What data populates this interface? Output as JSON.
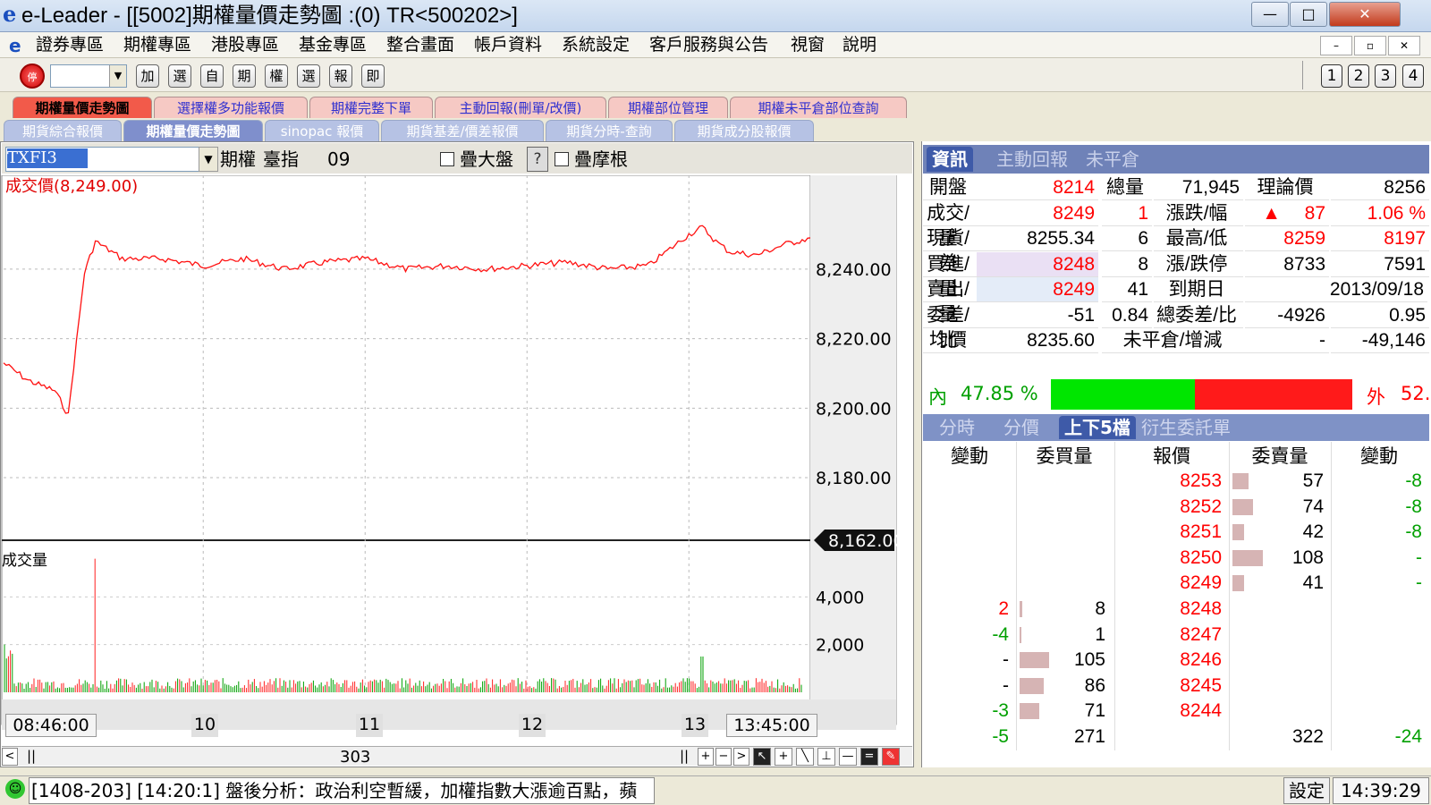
{
  "window": {
    "title": "e-Leader - [[5002]期權量價走勢圖 :(0) TR<500202>]",
    "logo": "e",
    "min": "—",
    "max": "□",
    "close": "✕"
  },
  "menu": [
    "證券專區",
    "期權專區",
    "港股專區",
    "基金專區",
    "整合畫面",
    "帳戶資料",
    "系統設定",
    "客戶服務與公告",
    "視窗",
    "說明"
  ],
  "mdi_buttons": [
    "–",
    "▫",
    "✕"
  ],
  "toolbar": {
    "stop": "停",
    "combo_value": "",
    "buttons": [
      "加",
      "選",
      "自",
      "期",
      "權",
      "選",
      "報",
      "即"
    ],
    "layout_buttons": [
      "1",
      "2",
      "3",
      "4"
    ]
  },
  "tabs_row1": [
    "期權量價走勢圖",
    "選擇權多功能報價",
    "期權完整下單",
    "主動回報(刪單/改價)",
    "期權部位管理",
    "期權未平倉部位查詢"
  ],
  "tabs_row2": [
    "期貨綜合報價",
    "期權量價走勢圖",
    "sinopac 報價",
    "期貨基差/價差報價",
    "期貨分時-查詢",
    "期貨成分股報價"
  ],
  "symbol": {
    "code": "TXFI3",
    "type": "期權",
    "name": "臺指",
    "month": "09",
    "overlay_index": "疊大盤",
    "help": "?",
    "overlay_msci": "疊摩根"
  },
  "chart": {
    "price_label": "成交價(8,249.00)",
    "volume_label": "成交量",
    "y_price_ticks": [
      "8,240.00",
      "8,220.00",
      "8,200.00",
      "8,180.00"
    ],
    "current_price_tag": "8,162.00",
    "y_volume_ticks": [
      "4,000",
      "2,000"
    ],
    "x_start": "08:46:00",
    "x_ticks": [
      "10",
      "11",
      "12",
      "13"
    ],
    "x_end": "13:45:00",
    "scroll_value": "303"
  },
  "chart_data": {
    "type": "line",
    "title": "成交價(8,249.00)",
    "ylabel": "",
    "ylim": [
      8162,
      8267
    ],
    "x_range": [
      "08:46",
      "13:45"
    ],
    "series": [
      {
        "name": "成交價",
        "x": [
          "08:46",
          "08:55",
          "09:05",
          "09:10",
          "09:13",
          "09:16",
          "09:20",
          "09:30",
          "09:45",
          "10:00",
          "10:15",
          "10:30",
          "10:45",
          "11:00",
          "11:15",
          "11:30",
          "11:45",
          "12:00",
          "12:15",
          "12:30",
          "12:45",
          "13:00",
          "13:05",
          "13:10",
          "13:15",
          "13:25",
          "13:35",
          "13:45"
        ],
        "values": [
          8213,
          8208,
          8205,
          8198,
          8219,
          8239,
          8248,
          8243,
          8243,
          8241,
          8243,
          8240,
          8242,
          8243,
          8240,
          8241,
          8240,
          8241,
          8242,
          8240,
          8241,
          8250,
          8252,
          8248,
          8245,
          8244,
          8247,
          8249
        ]
      }
    ],
    "volume": {
      "ylim": [
        0,
        6000
      ],
      "spike_times": [
        "08:46",
        "09:20",
        "13:05"
      ],
      "spike_values": [
        2000,
        5600,
        1500
      ]
    }
  },
  "info": {
    "tabs": [
      "資訊",
      "主動回報",
      "未平倉"
    ],
    "rows": [
      [
        "開盤",
        "8214",
        "總量",
        "71,945",
        "理論價",
        "",
        "8256"
      ],
      [
        "成交/量",
        "8249",
        "1",
        "漲跌/幅",
        "▲",
        "87",
        "1.06 %"
      ],
      [
        "現貨/差",
        "8255.34",
        "6",
        "最高/低",
        "8259",
        "8197"
      ],
      [
        "買進/量",
        "8248",
        "8",
        "漲/跌停",
        "8733",
        "7591"
      ],
      [
        "賣出/量",
        "8249",
        "41",
        "到期日",
        "2013/09/18"
      ],
      [
        "委差/比",
        "-51",
        "0.84",
        "總委差/比",
        "-4926",
        "0.95"
      ],
      [
        "均價",
        "8235.60",
        "未平倉/增減",
        "-",
        "-49,146"
      ]
    ]
  },
  "inout": {
    "in_label": "內",
    "in_pct": "47.85 %",
    "out_label": "外",
    "out_pct": "52.",
    "in_value": 47.85
  },
  "book": {
    "tabs": [
      "分時",
      "分價",
      "上下5檔",
      "衍生委託單"
    ],
    "headers": [
      "變動",
      "委買量",
      "報價",
      "委賣量",
      "變動"
    ],
    "asks": [
      [
        "8253",
        "57",
        "-8"
      ],
      [
        "8252",
        "74",
        "-8"
      ],
      [
        "8251",
        "42",
        "-8"
      ],
      [
        "8250",
        "108",
        "-"
      ],
      [
        "8249",
        "41",
        "-"
      ]
    ],
    "bids": [
      [
        "2",
        "8",
        "8248"
      ],
      [
        "-4",
        "1",
        "8247"
      ],
      [
        "-",
        "105",
        "8246"
      ],
      [
        "-",
        "86",
        "8245"
      ],
      [
        "-3",
        "71",
        "8244"
      ]
    ],
    "totals": [
      "-5",
      "271",
      "322",
      "-24"
    ]
  },
  "status": {
    "news": "[1408-203] [14:20:1] 盤後分析：政治利空暫緩，加權指數大漲逾百點，蘋",
    "settings": "設定",
    "time": "14:39:29",
    "smile": "☺"
  },
  "colors": {
    "up": "#ff0000",
    "down": "#00a000",
    "in_bar": "#00e600",
    "out_bar": "#ff1a1a"
  }
}
